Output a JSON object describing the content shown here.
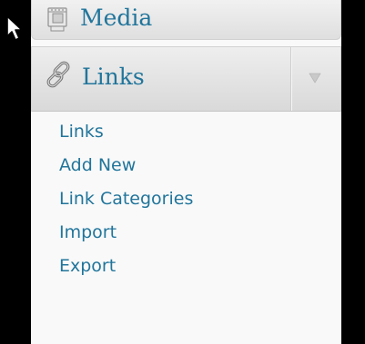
{
  "menu": {
    "media": {
      "label": "Media",
      "icon": "media-icon"
    },
    "links": {
      "label": "Links",
      "icon": "links-icon",
      "toggle_icon": "triangle-down-icon"
    },
    "submenu": [
      {
        "label": "Links"
      },
      {
        "label": "Add New"
      },
      {
        "label": "Link Categories"
      },
      {
        "label": "Import"
      },
      {
        "label": "Export"
      }
    ]
  },
  "colors": {
    "link_text": "#21759b",
    "panel_bg": "#f9f9f9",
    "page_bg": "#000000"
  }
}
